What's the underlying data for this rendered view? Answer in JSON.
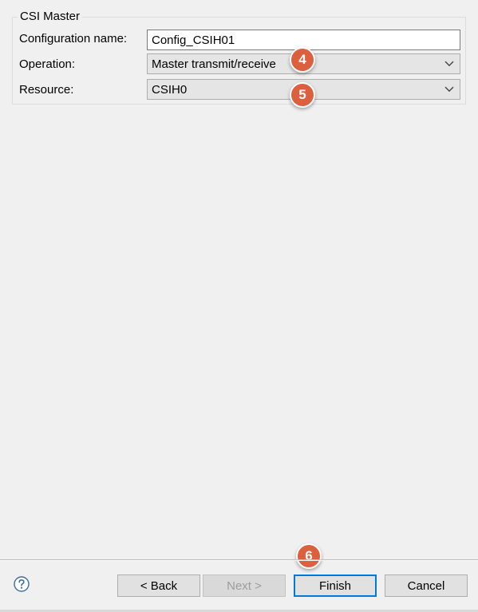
{
  "group": {
    "title": "CSI Master"
  },
  "form": {
    "config_label": "Configuration name:",
    "config_value": "Config_CSIH01",
    "operation_label": "Operation:",
    "operation_value": "Master transmit/receive",
    "resource_label": "Resource:",
    "resource_value": "CSIH0"
  },
  "badges": {
    "b4": "4",
    "b5": "5",
    "b6": "6"
  },
  "buttons": {
    "back": "< Back",
    "next": "Next >",
    "finish": "Finish",
    "cancel": "Cancel"
  },
  "icons": {
    "help": "help-icon",
    "dropdown": "chevron-down-icon"
  },
  "colors": {
    "badge": "#dc5f3e",
    "default_button_border": "#0078d7"
  }
}
